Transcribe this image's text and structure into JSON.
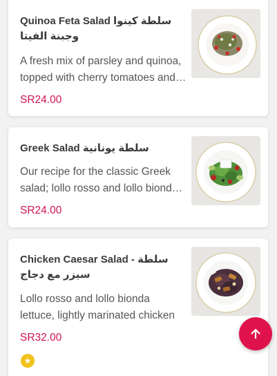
{
  "menu": {
    "items": [
      {
        "title": "Quinoa Feta Salad سلطة كينوا وجبنة الفيتا",
        "description": "A fresh mix of parsley and quinoa, topped with cherry tomatoes and feta cheese",
        "price": "SR24.00",
        "image_icon": "quinoa-salad-plate"
      },
      {
        "title": "Greek Salad سلطة يونانية",
        "description": "Our recipe for the classic Greek salad; lollo rosso and lollo bionda lettuce",
        "price": "SR24.00",
        "image_icon": "greek-salad-plate"
      },
      {
        "title": "Chicken Caesar Salad - سلطة سيزر مع دجاج",
        "description": "Lollo rosso and lollo bionda lettuce, lightly marinated chicken",
        "price": "SR32.00",
        "image_icon": "caesar-salad-plate",
        "badge_icon": "star-icon"
      }
    ]
  },
  "scroll_top_button": {
    "icon": "arrow-up-icon"
  },
  "colors": {
    "price": "#d0134f",
    "accent": "#e0124c",
    "badge": "#f2c21a"
  }
}
